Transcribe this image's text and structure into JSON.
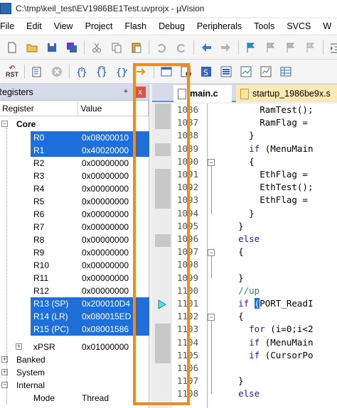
{
  "window": {
    "title": "C:\\tmp\\keil_test\\EV1986BE1Test.uvprojx - µVision"
  },
  "menu": [
    "File",
    "Edit",
    "View",
    "Project",
    "Flash",
    "Debug",
    "Peripherals",
    "Tools",
    "SVCS",
    "W"
  ],
  "toolbar1_icons": [
    "new-file-icon",
    "open-folder-icon",
    "save-icon",
    "save-all-icon",
    "cut-icon",
    "copy-icon",
    "paste-icon",
    "undo-icon",
    "redo-icon",
    "nav-back-icon",
    "nav-forward-icon",
    "bookmark-icon",
    "bookmark-prev-icon",
    "bookmark-next-icon",
    "bookmark-clear-icon",
    "indent-icon"
  ],
  "toolbar2": {
    "reset_label": "RST",
    "icons": [
      "reset-icon",
      "run-icon",
      "stop-icon",
      "step-into-icon",
      "step-over-icon",
      "step-out-icon",
      "run-to-cursor-icon",
      "command-window-icon",
      "disassembly-icon",
      "symbols-icon",
      "registers-icon",
      "call-stack-icon",
      "watch-icon",
      "memory-icon"
    ]
  },
  "registers_panel": {
    "title": "Registers",
    "pin": "⌖",
    "close": "x",
    "col_register": "Register",
    "col_value": "Value",
    "core_label": "Core",
    "rows": [
      {
        "name": "R0",
        "value": "0x08000010",
        "selected": true
      },
      {
        "name": "R1",
        "value": "0x40020000",
        "selected": true
      },
      {
        "name": "R2",
        "value": "0x00000000",
        "selected": false
      },
      {
        "name": "R3",
        "value": "0x00000000",
        "selected": false
      },
      {
        "name": "R4",
        "value": "0x00000000",
        "selected": false
      },
      {
        "name": "R5",
        "value": "0x00000000",
        "selected": false
      },
      {
        "name": "R6",
        "value": "0x00000000",
        "selected": false
      },
      {
        "name": "R7",
        "value": "0x00000000",
        "selected": false
      },
      {
        "name": "R8",
        "value": "0x00000000",
        "selected": false
      },
      {
        "name": "R9",
        "value": "0x00000000",
        "selected": false
      },
      {
        "name": "R10",
        "value": "0x00000000",
        "selected": false
      },
      {
        "name": "R11",
        "value": "0x00000000",
        "selected": false
      },
      {
        "name": "R12",
        "value": "0x00000000",
        "selected": false
      },
      {
        "name": "R13 (SP)",
        "value": "0x200010D4",
        "selected": true
      },
      {
        "name": "R14 (LR)",
        "value": "0x080015ED",
        "selected": true
      },
      {
        "name": "R15 (PC)",
        "value": "0x08001586",
        "selected": true
      }
    ],
    "xpsr": {
      "name": "xPSR",
      "value": "0x01000000"
    },
    "banked": "Banked",
    "system": "System",
    "internal": "Internal",
    "mode": {
      "name": "Mode",
      "value": "Thread"
    }
  },
  "editor": {
    "tabs": [
      {
        "label": "main.c",
        "active": true
      },
      {
        "label": "startup_1986be9x.s",
        "active": false
      }
    ],
    "lines": [
      {
        "num": "1086",
        "code": "        RamTest();"
      },
      {
        "num": "1087",
        "code": "        RamFlag = "
      },
      {
        "num": "1088",
        "code": "      }"
      },
      {
        "num": "1089",
        "code": "      if (MenuMain"
      },
      {
        "num": "1090",
        "code": "      {"
      },
      {
        "num": "1091",
        "code": "        EthFlag = "
      },
      {
        "num": "1092",
        "code": "        EthTest();"
      },
      {
        "num": "1093",
        "code": "        EthFlag = "
      },
      {
        "num": "1094",
        "code": "      }"
      },
      {
        "num": "1095",
        "code": "    }"
      },
      {
        "num": "1096",
        "code": "    else"
      },
      {
        "num": "1097",
        "code": "    {"
      },
      {
        "num": "1098",
        "code": ""
      },
      {
        "num": "1099",
        "code": "    }"
      },
      {
        "num": "1100",
        "code": "    //up"
      },
      {
        "num": "1101",
        "code": "    if (PORT_ReadI"
      },
      {
        "num": "1102",
        "code": "    {"
      },
      {
        "num": "1103",
        "code": "      for (i=0;i<2"
      },
      {
        "num": "1104",
        "code": "      if (MenuMain"
      },
      {
        "num": "1105",
        "code": "      if (CursorPo"
      },
      {
        "num": "1106",
        "code": ""
      },
      {
        "num": "1107",
        "code": "    }"
      },
      {
        "num": "1108",
        "code": "    else"
      }
    ]
  },
  "colors": {
    "selection": "#1e6fd9",
    "highlight_box": "#f08a24",
    "keyword": "#1a1aa6",
    "comment": "#2e8b57"
  }
}
